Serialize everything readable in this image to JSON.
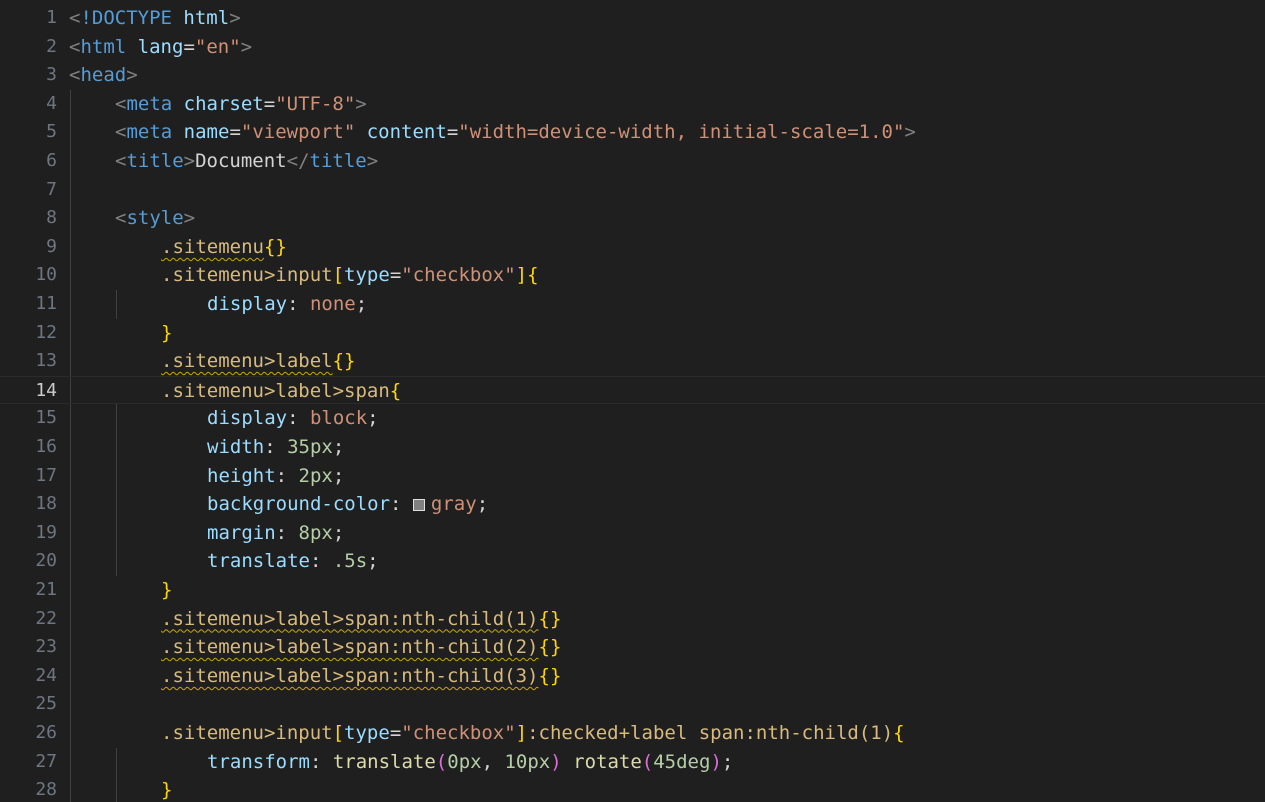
{
  "editor": {
    "current_line": 14,
    "color_swatch": "#808080",
    "lines": [
      {
        "n": "1",
        "indent": 0,
        "tokens": [
          {
            "t": "<",
            "c": "punct"
          },
          {
            "t": "!DOCTYPE",
            "c": "tag"
          },
          {
            "t": " ",
            "c": "text"
          },
          {
            "t": "html",
            "c": "attr"
          },
          {
            "t": ">",
            "c": "punct"
          }
        ]
      },
      {
        "n": "2",
        "indent": 0,
        "tokens": [
          {
            "t": "<",
            "c": "punct"
          },
          {
            "t": "html",
            "c": "tag"
          },
          {
            "t": " ",
            "c": "text"
          },
          {
            "t": "lang",
            "c": "attr"
          },
          {
            "t": "=",
            "c": "text"
          },
          {
            "t": "\"en\"",
            "c": "str"
          },
          {
            "t": ">",
            "c": "punct"
          }
        ]
      },
      {
        "n": "3",
        "indent": 0,
        "tokens": [
          {
            "t": "<",
            "c": "punct"
          },
          {
            "t": "head",
            "c": "tag"
          },
          {
            "t": ">",
            "c": "punct"
          }
        ]
      },
      {
        "n": "4",
        "indent": 1,
        "tokens": [
          {
            "t": "<",
            "c": "punct"
          },
          {
            "t": "meta",
            "c": "tag"
          },
          {
            "t": " ",
            "c": "text"
          },
          {
            "t": "charset",
            "c": "attr"
          },
          {
            "t": "=",
            "c": "text"
          },
          {
            "t": "\"UTF-8\"",
            "c": "str"
          },
          {
            "t": ">",
            "c": "punct"
          }
        ]
      },
      {
        "n": "5",
        "indent": 1,
        "tokens": [
          {
            "t": "<",
            "c": "punct"
          },
          {
            "t": "meta",
            "c": "tag"
          },
          {
            "t": " ",
            "c": "text"
          },
          {
            "t": "name",
            "c": "attr"
          },
          {
            "t": "=",
            "c": "text"
          },
          {
            "t": "\"viewport\"",
            "c": "str"
          },
          {
            "t": " ",
            "c": "text"
          },
          {
            "t": "content",
            "c": "attr"
          },
          {
            "t": "=",
            "c": "text"
          },
          {
            "t": "\"width=device-width, initial-scale=1.0\"",
            "c": "str"
          },
          {
            "t": ">",
            "c": "punct"
          }
        ]
      },
      {
        "n": "6",
        "indent": 1,
        "tokens": [
          {
            "t": "<",
            "c": "punct"
          },
          {
            "t": "title",
            "c": "tag"
          },
          {
            "t": ">",
            "c": "punct"
          },
          {
            "t": "Document",
            "c": "text"
          },
          {
            "t": "</",
            "c": "punct"
          },
          {
            "t": "title",
            "c": "tag"
          },
          {
            "t": ">",
            "c": "punct"
          }
        ]
      },
      {
        "n": "7",
        "indent": 0,
        "tokens": []
      },
      {
        "n": "8",
        "indent": 1,
        "tokens": [
          {
            "t": "<",
            "c": "punct"
          },
          {
            "t": "style",
            "c": "tag"
          },
          {
            "t": ">",
            "c": "punct"
          }
        ]
      },
      {
        "n": "9",
        "indent": 2,
        "tokens": [
          {
            "t": ".sitemenu",
            "c": "sel-warn"
          },
          {
            "t": "{}",
            "c": "brace"
          }
        ]
      },
      {
        "n": "10",
        "indent": 2,
        "tokens": [
          {
            "t": ".sitemenu",
            "c": "sel"
          },
          {
            "t": ">input",
            "c": "sel"
          },
          {
            "t": "[",
            "c": "sq"
          },
          {
            "t": "type",
            "c": "attr"
          },
          {
            "t": "=",
            "c": "text"
          },
          {
            "t": "\"checkbox\"",
            "c": "str"
          },
          {
            "t": "]",
            "c": "sq"
          },
          {
            "t": "{",
            "c": "brace"
          }
        ]
      },
      {
        "n": "11",
        "indent": 3,
        "tokens": [
          {
            "t": "display",
            "c": "prop"
          },
          {
            "t": ": ",
            "c": "text"
          },
          {
            "t": "none",
            "c": "val"
          },
          {
            "t": ";",
            "c": "text"
          }
        ]
      },
      {
        "n": "12",
        "indent": 2,
        "tokens": [
          {
            "t": "}",
            "c": "brace"
          }
        ]
      },
      {
        "n": "13",
        "indent": 2,
        "tokens": [
          {
            "t": ".sitemenu>label",
            "c": "sel-warn"
          },
          {
            "t": "{}",
            "c": "brace"
          }
        ]
      },
      {
        "n": "14",
        "indent": 2,
        "tokens": [
          {
            "t": ".sitemenu",
            "c": "sel"
          },
          {
            "t": ">label>span",
            "c": "sel"
          },
          {
            "t": "{",
            "c": "brace"
          }
        ]
      },
      {
        "n": "15",
        "indent": 3,
        "tokens": [
          {
            "t": "display",
            "c": "prop"
          },
          {
            "t": ": ",
            "c": "text"
          },
          {
            "t": "block",
            "c": "val"
          },
          {
            "t": ";",
            "c": "text"
          }
        ]
      },
      {
        "n": "16",
        "indent": 3,
        "tokens": [
          {
            "t": "width",
            "c": "prop"
          },
          {
            "t": ": ",
            "c": "text"
          },
          {
            "t": "35px",
            "c": "num"
          },
          {
            "t": ";",
            "c": "text"
          }
        ]
      },
      {
        "n": "17",
        "indent": 3,
        "tokens": [
          {
            "t": "height",
            "c": "prop"
          },
          {
            "t": ": ",
            "c": "text"
          },
          {
            "t": "2px",
            "c": "num"
          },
          {
            "t": ";",
            "c": "text"
          }
        ]
      },
      {
        "n": "18",
        "indent": 3,
        "swatch": true,
        "tokens": [
          {
            "t": "background-color",
            "c": "prop"
          },
          {
            "t": ": ",
            "c": "text"
          },
          {
            "t": "gray",
            "c": "val",
            "swatch": true
          },
          {
            "t": ";",
            "c": "text"
          }
        ]
      },
      {
        "n": "19",
        "indent": 3,
        "tokens": [
          {
            "t": "margin",
            "c": "prop"
          },
          {
            "t": ": ",
            "c": "text"
          },
          {
            "t": "8px",
            "c": "num"
          },
          {
            "t": ";",
            "c": "text"
          }
        ]
      },
      {
        "n": "20",
        "indent": 3,
        "tokens": [
          {
            "t": "translate",
            "c": "prop"
          },
          {
            "t": ": ",
            "c": "text"
          },
          {
            "t": ".5s",
            "c": "num"
          },
          {
            "t": ";",
            "c": "text"
          }
        ]
      },
      {
        "n": "21",
        "indent": 2,
        "tokens": [
          {
            "t": "}",
            "c": "brace"
          }
        ]
      },
      {
        "n": "22",
        "indent": 2,
        "tokens": [
          {
            "t": ".sitemenu>label>span:nth-child(1)",
            "c": "sel-warn"
          },
          {
            "t": "{}",
            "c": "brace"
          }
        ]
      },
      {
        "n": "23",
        "indent": 2,
        "tokens": [
          {
            "t": ".sitemenu>label>span:nth-child(2)",
            "c": "sel-warn"
          },
          {
            "t": "{}",
            "c": "brace"
          }
        ]
      },
      {
        "n": "24",
        "indent": 2,
        "tokens": [
          {
            "t": ".sitemenu>label>span:nth-child(3)",
            "c": "sel-warn"
          },
          {
            "t": "{}",
            "c": "brace"
          }
        ]
      },
      {
        "n": "25",
        "indent": 0,
        "tokens": []
      },
      {
        "n": "26",
        "indent": 2,
        "tokens": [
          {
            "t": ".sitemenu>input",
            "c": "sel"
          },
          {
            "t": "[",
            "c": "sq"
          },
          {
            "t": "type",
            "c": "attr"
          },
          {
            "t": "=",
            "c": "text"
          },
          {
            "t": "\"checkbox\"",
            "c": "str"
          },
          {
            "t": "]",
            "c": "sq"
          },
          {
            "t": ":checked+label span:nth-child(1)",
            "c": "sel"
          },
          {
            "t": "{",
            "c": "brace"
          }
        ]
      },
      {
        "n": "27",
        "indent": 3,
        "tokens": [
          {
            "t": "transform",
            "c": "prop"
          },
          {
            "t": ": ",
            "c": "text"
          },
          {
            "t": "translate",
            "c": "fn"
          },
          {
            "t": "(",
            "c": "paren"
          },
          {
            "t": "0px",
            "c": "num"
          },
          {
            "t": ", ",
            "c": "text"
          },
          {
            "t": "10px",
            "c": "num"
          },
          {
            "t": ")",
            "c": "paren"
          },
          {
            "t": " ",
            "c": "text"
          },
          {
            "t": "rotate",
            "c": "fn"
          },
          {
            "t": "(",
            "c": "paren"
          },
          {
            "t": "45deg",
            "c": "num"
          },
          {
            "t": ")",
            "c": "paren"
          },
          {
            "t": ";",
            "c": "text"
          }
        ]
      },
      {
        "n": "28",
        "indent": 2,
        "tokens": [
          {
            "t": "}",
            "c": "brace"
          }
        ]
      }
    ]
  }
}
